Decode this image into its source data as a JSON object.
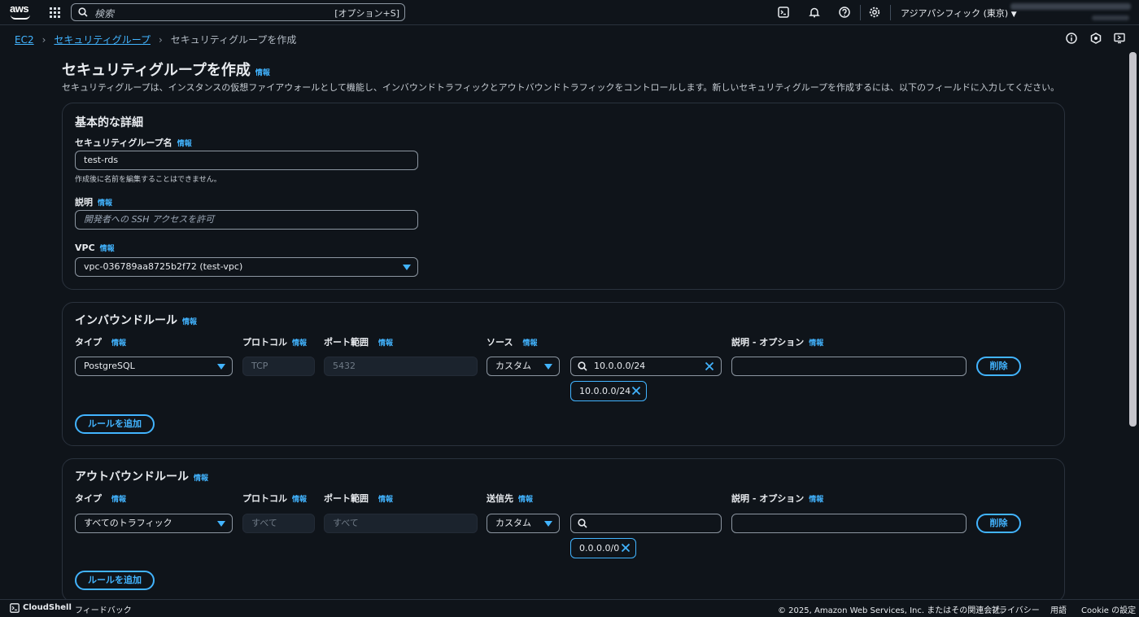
{
  "topnav": {
    "logo_text": "aws",
    "search_placeholder": "検索",
    "search_shortcut": "[オプション+S]",
    "region": "アジアパシフィック (東京)"
  },
  "breadcrumb": [
    "EC2",
    "セキュリティグループ",
    "セキュリティグループを作成"
  ],
  "page": {
    "title": "セキュリティグループを作成",
    "info": "情報",
    "description": "セキュリティグループは、インスタンスの仮想ファイアウォールとして機能し、インバウンドトラフィックとアウトバウンドトラフィックをコントロールします。新しいセキュリティグループを作成するには、以下のフィールドに入力してください。"
  },
  "basic": {
    "title": "基本的な詳細",
    "name_label": "セキュリティグループ名",
    "name_value": "test-rds",
    "name_hint": "作成後に名前を編集することはできません。",
    "desc_label": "説明",
    "desc_placeholder": "開発者への SSH アクセスを許可",
    "vpc_label": "VPC",
    "vpc_value": "vpc-036789aa8725b2f72 (test-vpc)"
  },
  "inbound": {
    "title": "インバウンドルール",
    "col_type": "タイプ",
    "col_protocol": "プロトコル",
    "col_port": "ポート範囲",
    "col_source": "ソース",
    "col_desc": "説明 - オプション",
    "type_value": "PostgreSQL",
    "protocol_value": "TCP",
    "port_value": "5432",
    "source_mode": "カスタム",
    "source_value": "10.0.0.0/24",
    "source_token": "10.0.0.0/24",
    "delete_label": "削除",
    "add_rule_label": "ルールを追加"
  },
  "outbound": {
    "title": "アウトバウンドルール",
    "col_type": "タイプ",
    "col_protocol": "プロトコル",
    "col_port": "ポート範囲",
    "col_dest": "送信先",
    "col_desc": "説明 - オプション",
    "type_value": "すべてのトラフィック",
    "protocol_value": "すべて",
    "port_value": "すべて",
    "dest_mode": "カスタム",
    "dest_token": "0.0.0.0/0",
    "delete_label": "削除",
    "add_rule_label": "ルールを追加"
  },
  "footer": {
    "cloudshell": "CloudShell",
    "feedback": "フィードバック",
    "copyright": "© 2025, Amazon Web Services, Inc. またはその関連会社。",
    "privacy": "プライバシー",
    "terms": "用語",
    "cookie": "Cookie の設定"
  },
  "colors": {
    "accent": "#42b4ff",
    "background": "#0f141a",
    "border": "#8c96a1"
  }
}
